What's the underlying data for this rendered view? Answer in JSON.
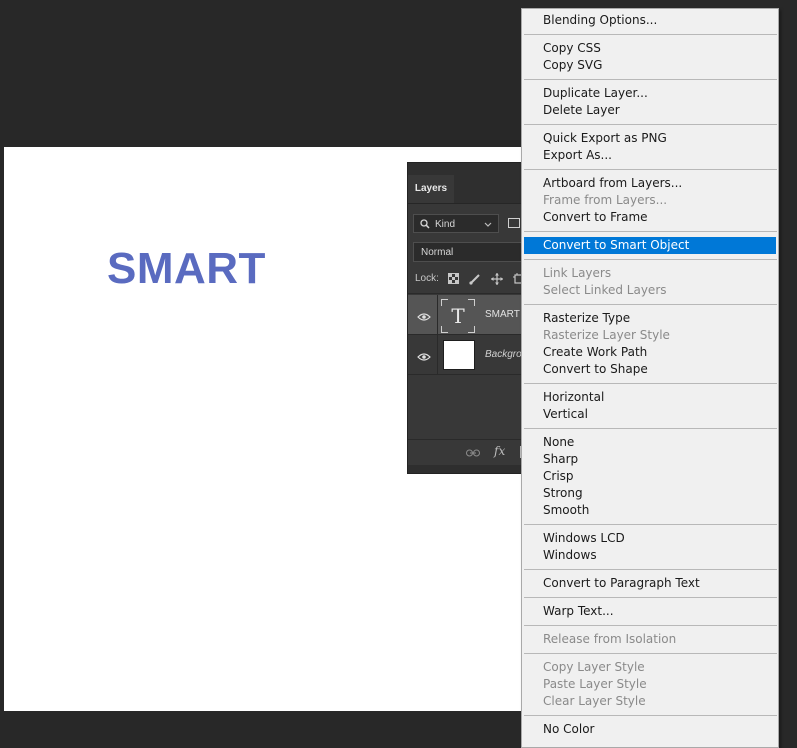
{
  "canvas": {
    "text": "SMART",
    "text_color": "#5a6bc0"
  },
  "layers_panel": {
    "tab": "Layers",
    "kind_label": "Kind",
    "blend_mode": "Normal",
    "lock_label": "Lock:",
    "layers": [
      {
        "name": "SMART",
        "type": "text",
        "thumb_glyph": "T",
        "selected": true
      },
      {
        "name": "Backgro",
        "type": "background",
        "selected": false
      }
    ],
    "footer_icons": [
      "link-icon",
      "fx-icon"
    ],
    "footer_fx": "fx"
  },
  "context_menu": {
    "highlight_color": "#0078d7",
    "groups": [
      [
        {
          "label": "Blending Options...",
          "enabled": true
        }
      ],
      [
        {
          "label": "Copy CSS",
          "enabled": true
        },
        {
          "label": "Copy SVG",
          "enabled": true
        }
      ],
      [
        {
          "label": "Duplicate Layer...",
          "enabled": true
        },
        {
          "label": "Delete Layer",
          "enabled": true
        }
      ],
      [
        {
          "label": "Quick Export as PNG",
          "enabled": true
        },
        {
          "label": "Export As...",
          "enabled": true
        }
      ],
      [
        {
          "label": "Artboard from Layers...",
          "enabled": true
        },
        {
          "label": "Frame from Layers...",
          "enabled": false
        },
        {
          "label": "Convert to Frame",
          "enabled": true
        }
      ],
      [
        {
          "label": "Convert to Smart Object",
          "enabled": true,
          "highlighted": true
        }
      ],
      [
        {
          "label": "Link Layers",
          "enabled": false
        },
        {
          "label": "Select Linked Layers",
          "enabled": false
        }
      ],
      [
        {
          "label": "Rasterize Type",
          "enabled": true
        },
        {
          "label": "Rasterize Layer Style",
          "enabled": false
        },
        {
          "label": "Create Work Path",
          "enabled": true
        },
        {
          "label": "Convert to Shape",
          "enabled": true
        }
      ],
      [
        {
          "label": "Horizontal",
          "enabled": true
        },
        {
          "label": "Vertical",
          "enabled": true
        }
      ],
      [
        {
          "label": "None",
          "enabled": true
        },
        {
          "label": "Sharp",
          "enabled": true
        },
        {
          "label": "Crisp",
          "enabled": true
        },
        {
          "label": "Strong",
          "enabled": true
        },
        {
          "label": "Smooth",
          "enabled": true
        }
      ],
      [
        {
          "label": "Windows LCD",
          "enabled": true
        },
        {
          "label": "Windows",
          "enabled": true
        }
      ],
      [
        {
          "label": "Convert to Paragraph Text",
          "enabled": true
        }
      ],
      [
        {
          "label": "Warp Text...",
          "enabled": true
        }
      ],
      [
        {
          "label": "Release from Isolation",
          "enabled": false
        }
      ],
      [
        {
          "label": "Copy Layer Style",
          "enabled": false
        },
        {
          "label": "Paste Layer Style",
          "enabled": false
        },
        {
          "label": "Clear Layer Style",
          "enabled": false
        }
      ],
      [
        {
          "label": "No Color",
          "enabled": true
        }
      ]
    ]
  }
}
